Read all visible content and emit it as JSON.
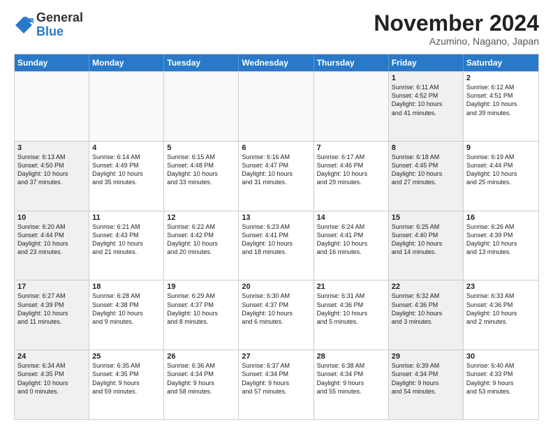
{
  "logo": {
    "general": "General",
    "blue": "Blue"
  },
  "title": "November 2024",
  "location": "Azumino, Nagano, Japan",
  "header_days": [
    "Sunday",
    "Monday",
    "Tuesday",
    "Wednesday",
    "Thursday",
    "Friday",
    "Saturday"
  ],
  "weeks": [
    [
      {
        "day": "",
        "text": "",
        "empty": true
      },
      {
        "day": "",
        "text": "",
        "empty": true
      },
      {
        "day": "",
        "text": "",
        "empty": true
      },
      {
        "day": "",
        "text": "",
        "empty": true
      },
      {
        "day": "",
        "text": "",
        "empty": true
      },
      {
        "day": "1",
        "text": "Sunrise: 6:11 AM\nSunset: 4:52 PM\nDaylight: 10 hours\nand 41 minutes.",
        "shaded": true
      },
      {
        "day": "2",
        "text": "Sunrise: 6:12 AM\nSunset: 4:51 PM\nDaylight: 10 hours\nand 39 minutes."
      }
    ],
    [
      {
        "day": "3",
        "text": "Sunrise: 6:13 AM\nSunset: 4:50 PM\nDaylight: 10 hours\nand 37 minutes.",
        "shaded": true
      },
      {
        "day": "4",
        "text": "Sunrise: 6:14 AM\nSunset: 4:49 PM\nDaylight: 10 hours\nand 35 minutes."
      },
      {
        "day": "5",
        "text": "Sunrise: 6:15 AM\nSunset: 4:48 PM\nDaylight: 10 hours\nand 33 minutes."
      },
      {
        "day": "6",
        "text": "Sunrise: 6:16 AM\nSunset: 4:47 PM\nDaylight: 10 hours\nand 31 minutes."
      },
      {
        "day": "7",
        "text": "Sunrise: 6:17 AM\nSunset: 4:46 PM\nDaylight: 10 hours\nand 29 minutes."
      },
      {
        "day": "8",
        "text": "Sunrise: 6:18 AM\nSunset: 4:45 PM\nDaylight: 10 hours\nand 27 minutes.",
        "shaded": true
      },
      {
        "day": "9",
        "text": "Sunrise: 6:19 AM\nSunset: 4:44 PM\nDaylight: 10 hours\nand 25 minutes."
      }
    ],
    [
      {
        "day": "10",
        "text": "Sunrise: 6:20 AM\nSunset: 4:44 PM\nDaylight: 10 hours\nand 23 minutes.",
        "shaded": true
      },
      {
        "day": "11",
        "text": "Sunrise: 6:21 AM\nSunset: 4:43 PM\nDaylight: 10 hours\nand 21 minutes."
      },
      {
        "day": "12",
        "text": "Sunrise: 6:22 AM\nSunset: 4:42 PM\nDaylight: 10 hours\nand 20 minutes."
      },
      {
        "day": "13",
        "text": "Sunrise: 6:23 AM\nSunset: 4:41 PM\nDaylight: 10 hours\nand 18 minutes."
      },
      {
        "day": "14",
        "text": "Sunrise: 6:24 AM\nSunset: 4:41 PM\nDaylight: 10 hours\nand 16 minutes."
      },
      {
        "day": "15",
        "text": "Sunrise: 6:25 AM\nSunset: 4:40 PM\nDaylight: 10 hours\nand 14 minutes.",
        "shaded": true
      },
      {
        "day": "16",
        "text": "Sunrise: 6:26 AM\nSunset: 4:39 PM\nDaylight: 10 hours\nand 13 minutes."
      }
    ],
    [
      {
        "day": "17",
        "text": "Sunrise: 6:27 AM\nSunset: 4:39 PM\nDaylight: 10 hours\nand 11 minutes.",
        "shaded": true
      },
      {
        "day": "18",
        "text": "Sunrise: 6:28 AM\nSunset: 4:38 PM\nDaylight: 10 hours\nand 9 minutes."
      },
      {
        "day": "19",
        "text": "Sunrise: 6:29 AM\nSunset: 4:37 PM\nDaylight: 10 hours\nand 8 minutes."
      },
      {
        "day": "20",
        "text": "Sunrise: 6:30 AM\nSunset: 4:37 PM\nDaylight: 10 hours\nand 6 minutes."
      },
      {
        "day": "21",
        "text": "Sunrise: 6:31 AM\nSunset: 4:36 PM\nDaylight: 10 hours\nand 5 minutes."
      },
      {
        "day": "22",
        "text": "Sunrise: 6:32 AM\nSunset: 4:36 PM\nDaylight: 10 hours\nand 3 minutes.",
        "shaded": true
      },
      {
        "day": "23",
        "text": "Sunrise: 6:33 AM\nSunset: 4:36 PM\nDaylight: 10 hours\nand 2 minutes."
      }
    ],
    [
      {
        "day": "24",
        "text": "Sunrise: 6:34 AM\nSunset: 4:35 PM\nDaylight: 10 hours\nand 0 minutes.",
        "shaded": true
      },
      {
        "day": "25",
        "text": "Sunrise: 6:35 AM\nSunset: 4:35 PM\nDaylight: 9 hours\nand 59 minutes."
      },
      {
        "day": "26",
        "text": "Sunrise: 6:36 AM\nSunset: 4:34 PM\nDaylight: 9 hours\nand 58 minutes."
      },
      {
        "day": "27",
        "text": "Sunrise: 6:37 AM\nSunset: 4:34 PM\nDaylight: 9 hours\nand 57 minutes."
      },
      {
        "day": "28",
        "text": "Sunrise: 6:38 AM\nSunset: 4:34 PM\nDaylight: 9 hours\nand 55 minutes."
      },
      {
        "day": "29",
        "text": "Sunrise: 6:39 AM\nSunset: 4:34 PM\nDaylight: 9 hours\nand 54 minutes.",
        "shaded": true
      },
      {
        "day": "30",
        "text": "Sunrise: 6:40 AM\nSunset: 4:33 PM\nDaylight: 9 hours\nand 53 minutes."
      }
    ]
  ]
}
